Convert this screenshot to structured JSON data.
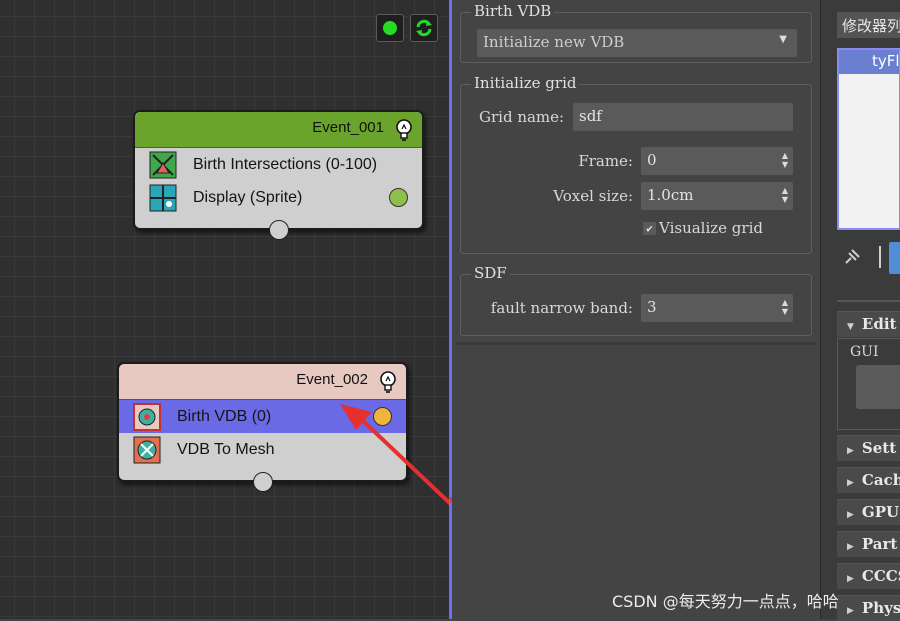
{
  "graph": {
    "toolbar": {
      "status_icon": "green-dot-icon",
      "refresh_icon": "refresh-icon"
    },
    "nodes": [
      {
        "title": "Event_001",
        "header_color": "#6aa42c",
        "operators": [
          {
            "label": "Birth Intersections (0-100)",
            "icon": "birth-intersections-icon"
          },
          {
            "label": "Display (Sprite)",
            "icon": "display-icon",
            "port_color": "#8fbf4a"
          }
        ]
      },
      {
        "title": "Event_002",
        "header_color": "#e8c9c2",
        "operators": [
          {
            "label": "Birth VDB (0)",
            "icon": "birth-vdb-icon",
            "port_color": "#f0b43a",
            "selected": true
          },
          {
            "label": "VDB To Mesh",
            "icon": "vdb-to-mesh-icon"
          }
        ]
      }
    ],
    "selection_color": "#6a6ae6",
    "annotation_arrow_color": "#e53030"
  },
  "params": {
    "birth_vdb": {
      "title": "Birth VDB",
      "mode_value": "Initialize new VDB"
    },
    "initialize_grid": {
      "title": "Initialize grid",
      "grid_name_label": "Grid name:",
      "grid_name_value": "sdf",
      "frame_label": "Frame:",
      "frame_value": "0",
      "voxel_label": "Voxel size:",
      "voxel_value": "1.0cm",
      "visualize_label": "Visualize grid",
      "visualize_checked": true
    },
    "sdf": {
      "title": "SDF",
      "band_label": "fault narrow band:",
      "band_value": "3"
    }
  },
  "command_panel": {
    "modifier_list_label": "修改器列",
    "stack_item": "tyFl",
    "gui_label": "GUI",
    "rollouts": [
      "Edit",
      "Sett",
      "Cach",
      "GPU",
      "Part",
      "CCCS",
      "Phys"
    ]
  },
  "watermark": "CSDN @每天努力一点点，哈哈"
}
